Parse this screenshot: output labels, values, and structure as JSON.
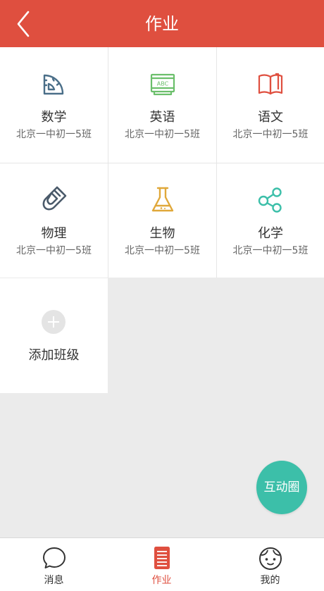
{
  "header": {
    "title": "作业",
    "back_icon": "chevron-left-icon"
  },
  "subjects": [
    {
      "name": "数学",
      "class": "北京一中初一5班",
      "icon": "protractor-icon",
      "color": "#4a6e88"
    },
    {
      "name": "英语",
      "class": "北京一中初一5班",
      "icon": "abc-book-icon",
      "color": "#6bbf6b"
    },
    {
      "name": "语文",
      "class": "北京一中初一5班",
      "icon": "open-book-icon",
      "color": "#df4f3f"
    },
    {
      "name": "物理",
      "class": "北京一中初一5班",
      "icon": "magnet-icon",
      "color": "#4a5a6a"
    },
    {
      "name": "生物",
      "class": "北京一中初一5班",
      "icon": "flask-icon",
      "color": "#e0a83a"
    },
    {
      "name": "化学",
      "class": "北京一中初一5班",
      "icon": "molecule-icon",
      "color": "#3cbfa9"
    }
  ],
  "add_class": {
    "label": "添加班级",
    "icon": "plus-icon"
  },
  "fab": {
    "label": "互动圈"
  },
  "tabbar": {
    "items": [
      {
        "label": "消息",
        "icon": "chat-bubble-icon",
        "active": false
      },
      {
        "label": "作业",
        "icon": "notebook-icon",
        "active": true
      },
      {
        "label": "我的",
        "icon": "face-icon",
        "active": false
      }
    ]
  },
  "colors": {
    "brand": "#df4f3f",
    "accent": "#3cbfa9"
  }
}
